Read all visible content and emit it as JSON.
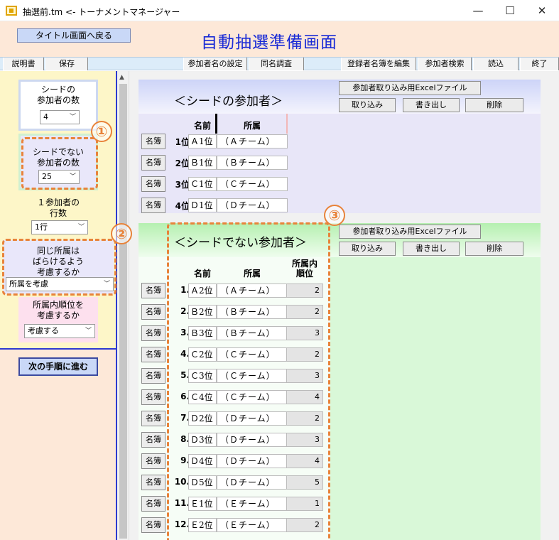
{
  "window": {
    "title": "抽選前.tm <- トーナメントマネージャー",
    "minimize": "—",
    "maximize": "☐",
    "close": "✕"
  },
  "header": {
    "back_button": "タイトル画面へ戻る",
    "page_title": "自動抽選準備画面"
  },
  "toolbar": {
    "manual": "説明書",
    "save": "保存",
    "participant_name_settings": "参加者名の設定",
    "same_name_check": "同名調査",
    "edit_registry": "登録者名簿を編集",
    "search_participant": "参加者検索",
    "load": "読込",
    "exit": "終了"
  },
  "left_panel": {
    "seed_count_label_1": "シードの",
    "seed_count_label_2": "参加者の数",
    "seed_count_value": "4",
    "nonseed_count_label_1": "シードでない",
    "nonseed_count_label_2": "参加者の数",
    "nonseed_count_value": "25",
    "rows_label_1": "１参加者の",
    "rows_label_2": "行数",
    "rows_value": "1行",
    "spread_label_1": "同じ所属は",
    "spread_label_2": "ばらけるよう",
    "spread_label_3": "考慮するか",
    "spread_value": "所属を考慮",
    "order_label_1": "所属内順位を",
    "order_label_2": "考慮するか",
    "order_value": "考慮する",
    "next_button": "次の手順に進む"
  },
  "seed_section": {
    "title": "＜シードの参加者＞",
    "excel_button": "参加者取り込み用Excelファイル",
    "import_button": "取り込み",
    "export_button": "書き出し",
    "delete_button": "削除",
    "col_name": "名前",
    "col_affiliation": "所属",
    "meibo_label": "名簿",
    "rows": [
      {
        "rank": "1位",
        "name": "Ａ1位",
        "team": "（Ａチーム）"
      },
      {
        "rank": "2位",
        "name": "Ｂ1位",
        "team": "（Ｂチーム）"
      },
      {
        "rank": "3位",
        "name": "Ｃ1位",
        "team": "（Ｃチーム）"
      },
      {
        "rank": "4位",
        "name": "Ｄ1位",
        "team": "（Ｄチーム）"
      }
    ]
  },
  "nonseed_section": {
    "title": "＜シードでない参加者＞",
    "excel_button": "参加者取り込み用Excelファイル",
    "import_button": "取り込み",
    "export_button": "書き出し",
    "delete_button": "削除",
    "col_name": "名前",
    "col_affiliation": "所属",
    "col_order_1": "所属内",
    "col_order_2": "順位",
    "meibo_label": "名簿",
    "rows": [
      {
        "no": "1.",
        "name": "Ａ2位",
        "team": "（Ａチーム）",
        "order": "2"
      },
      {
        "no": "2.",
        "name": "Ｂ2位",
        "team": "（Ｂチーム）",
        "order": "2"
      },
      {
        "no": "3.",
        "name": "Ｂ3位",
        "team": "（Ｂチーム）",
        "order": "3"
      },
      {
        "no": "4.",
        "name": "Ｃ2位",
        "team": "（Ｃチーム）",
        "order": "2"
      },
      {
        "no": "5.",
        "name": "Ｃ3位",
        "team": "（Ｃチーム）",
        "order": "3"
      },
      {
        "no": "6.",
        "name": "Ｃ4位",
        "team": "（Ｃチーム）",
        "order": "4"
      },
      {
        "no": "7.",
        "name": "Ｄ2位",
        "team": "（Ｄチーム）",
        "order": "2"
      },
      {
        "no": "8.",
        "name": "Ｄ3位",
        "team": "（Ｄチーム）",
        "order": "3"
      },
      {
        "no": "9.",
        "name": "Ｄ4位",
        "team": "（Ｄチーム）",
        "order": "4"
      },
      {
        "no": "10.",
        "name": "Ｄ5位",
        "team": "（Ｄチーム）",
        "order": "5"
      },
      {
        "no": "11.",
        "name": "Ｅ1位",
        "team": "（Ｅチーム）",
        "order": "1"
      },
      {
        "no": "12.",
        "name": "Ｅ2位",
        "team": "（Ｅチーム）",
        "order": "2"
      }
    ]
  },
  "annotations": {
    "badge_1": "①",
    "badge_2": "②",
    "badge_3": "③",
    "color": "#e8833a"
  }
}
